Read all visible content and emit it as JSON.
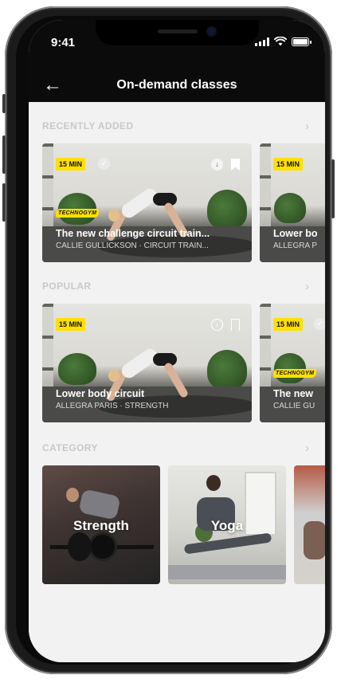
{
  "status_bar": {
    "time": "9:41"
  },
  "header": {
    "back_icon": "arrow-left-icon",
    "title": "On-demand classes"
  },
  "sections": [
    {
      "label": "RECENTLY ADDED",
      "cards": [
        {
          "duration": "15 MIN",
          "brand": "TECHNOGYM",
          "title": "The new challenge circuit train...",
          "subtitle": "CALLIE GULLICKSON · CIRCUIT TRAIN..."
        },
        {
          "duration": "15 MIN",
          "title": "Lower bo",
          "subtitle": "ALLEGRA P"
        }
      ]
    },
    {
      "label": "POPULAR",
      "cards": [
        {
          "duration": "15 MIN",
          "title": "Lower body circuit",
          "subtitle": "ALLEGRA PARIS · STRENGTH"
        },
        {
          "duration": "15 MIN",
          "brand": "TECHNOGYM",
          "title": "The new",
          "subtitle": "CALLIE GU"
        }
      ]
    },
    {
      "label": "CATEGORY",
      "categories": [
        {
          "label": "Strength"
        },
        {
          "label": "Yoga"
        }
      ]
    }
  ],
  "colors": {
    "accent": "#ffe000",
    "header_bg": "#0b0b0b",
    "screen_bg": "#f2f2f2",
    "section_label": "#c9c9c9"
  },
  "icons": {
    "check": "check-circle-icon",
    "download": "download-icon",
    "bookmark": "bookmark-icon",
    "chevron": "chevron-right-icon"
  }
}
